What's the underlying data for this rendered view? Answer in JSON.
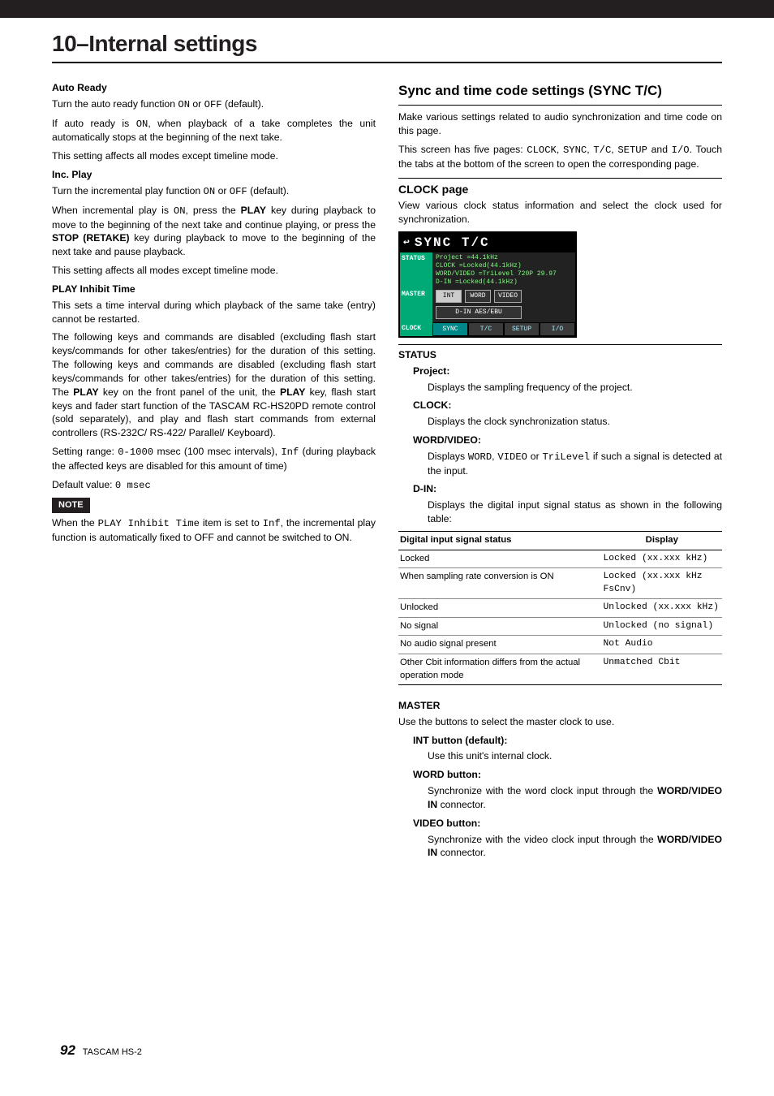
{
  "chapter": "10–Internal settings",
  "left": {
    "autoReady": {
      "title": "Auto Ready",
      "p1a": "Turn the auto ready function ",
      "on": "ON",
      "p1b": " or ",
      "off": "OFF",
      "p1c": " (default).",
      "p2a": "If auto ready is ",
      "on2": "ON",
      "p2b": ", when playback of a take completes the unit automatically stops at the beginning of the next take.",
      "p3": "This setting affects all modes except timeline mode."
    },
    "incPlay": {
      "title": "Inc. Play",
      "p1a": "Turn the incremental play function ",
      "on": "ON",
      "p1b": " or ",
      "off": "OFF",
      "p1c": " (default).",
      "p2a": "When incremental play is ",
      "on2": "ON",
      "p2b": ", press the ",
      "playKey": "PLAY",
      "p2c": " key during playback to move to the beginning of the next take and continue playing, or press the ",
      "stopKey": "STOP (RETAKE)",
      "p2d": " key during playback to move to the beginning of the next take and pause playback.",
      "p3": "This setting affects all modes except timeline mode."
    },
    "inhibit": {
      "title": "PLAY Inhibit Time",
      "p1": "This sets a time interval during which playback of the same take (entry) cannot be restarted.",
      "p2a": "The following keys and commands are disabled (excluding flash start keys/commands for other takes/entries) for the duration of this setting. The following keys and commands are disabled (excluding flash start keys/commands for other takes/entries) for the duration of this setting. The ",
      "playKey1": "PLAY",
      "p2b": " key on the front panel of the unit, the ",
      "playKey2": "PLAY",
      "p2c": " key, flash start keys and fader start function of the TASCAM RC-HS20PD remote control (sold separately), and play and flash start commands from external controllers (RS-232C/ RS-422/ Parallel/ Keyboard).",
      "rangeLabel": "Setting range: ",
      "rangeVal": "0-1000",
      "rangeMid": " msec (100 msec intervals), ",
      "inf": "Inf",
      "rangeEnd": " (during playback the affected keys are disabled for this amount of time)",
      "defLabel": "Default value: ",
      "defVal": "0 msec"
    },
    "note": {
      "label": "NOTE",
      "t1": "When the ",
      "item": "PLAY Inhibit Time",
      "t2": " item is set to ",
      "inf": "Inf",
      "t3": ", the incremental play function is automatically fixed to OFF and cannot be switched to ON."
    }
  },
  "right": {
    "syncTitle": "Sync and time code settings (SYNC T/C)",
    "syncP1": "Make various settings related to audio synchronization and time code on this page.",
    "syncP2a": "This screen has five pages: ",
    "pages": [
      "CLOCK",
      "SYNC",
      "T/C",
      "SETUP",
      "I/O"
    ],
    "syncP2b": " and ",
    "syncP2c": ". Touch the tabs at the bottom of the screen to open the corresponding page.",
    "clockPage": {
      "title": "CLOCK page",
      "desc": "View various clock status information and select the clock used for synchronization."
    },
    "figure": {
      "title": "SYNC T/C",
      "statusLabel": "STATUS",
      "masterLabel": "MASTER",
      "clockLabel": "CLOCK",
      "lines": [
        {
          "k": "Project",
          "v": "=44.1kHz"
        },
        {
          "k": "CLOCK",
          "v": "=Locked(44.1kHz)"
        },
        {
          "k": "WORD/VIDEO",
          "v": "=TriLevel 720P 29.97"
        },
        {
          "k": "D-IN",
          "v": "=Locked(44.1kHz)"
        }
      ],
      "buttons": [
        "INT",
        "WORD",
        "VIDEO",
        "D-IN\nAES/EBU"
      ],
      "tabs": [
        "SYNC",
        "T/C",
        "SETUP",
        "I/O"
      ]
    },
    "status": {
      "title": "STATUS",
      "project": {
        "title": "Project:",
        "desc": "Displays the sampling frequency of the project."
      },
      "clock": {
        "title": "CLOCK:",
        "desc": "Displays the clock synchronization status."
      },
      "wordVideo": {
        "title": "WORD/VIDEO:",
        "d1": "Displays ",
        "w": "WORD",
        "v": "VIDEO",
        "d2": " or ",
        "t": "TriLevel",
        "d3": " if such a signal is detected at the input."
      },
      "din": {
        "title": "D-IN:",
        "desc": "Displays the digital input signal status as shown in the following table:"
      }
    },
    "table": {
      "head": [
        "Digital input signal status",
        "Display"
      ],
      "rows": [
        [
          "Locked",
          "Locked (xx.xxx kHz)"
        ],
        [
          "When sampling rate conversion is ON",
          "Locked (xx.xxx kHz FsCnv)"
        ],
        [
          "Unlocked",
          "Unlocked (xx.xxx kHz)"
        ],
        [
          "No signal",
          "Unlocked (no signal)"
        ],
        [
          "No audio signal present",
          "Not Audio"
        ],
        [
          "Other Cbit information differs from the actual operation mode",
          "Unmatched Cbit"
        ]
      ]
    },
    "master": {
      "title": "MASTER",
      "desc": "Use the buttons to select the master clock to use.",
      "int": {
        "title": "INT button (default):",
        "desc": "Use this unit's internal clock."
      },
      "word": {
        "title": "WORD button:",
        "d1": "Synchronize with the word clock input through the ",
        "conn": "WORD/VIDEO IN",
        "d2": " connector."
      },
      "video": {
        "title": "VIDEO button:",
        "d1": "Synchronize with the video clock input through the ",
        "conn": "WORD/VIDEO IN",
        "d2": " connector."
      }
    }
  },
  "footer": {
    "page": "92",
    "model": "TASCAM HS-2"
  }
}
